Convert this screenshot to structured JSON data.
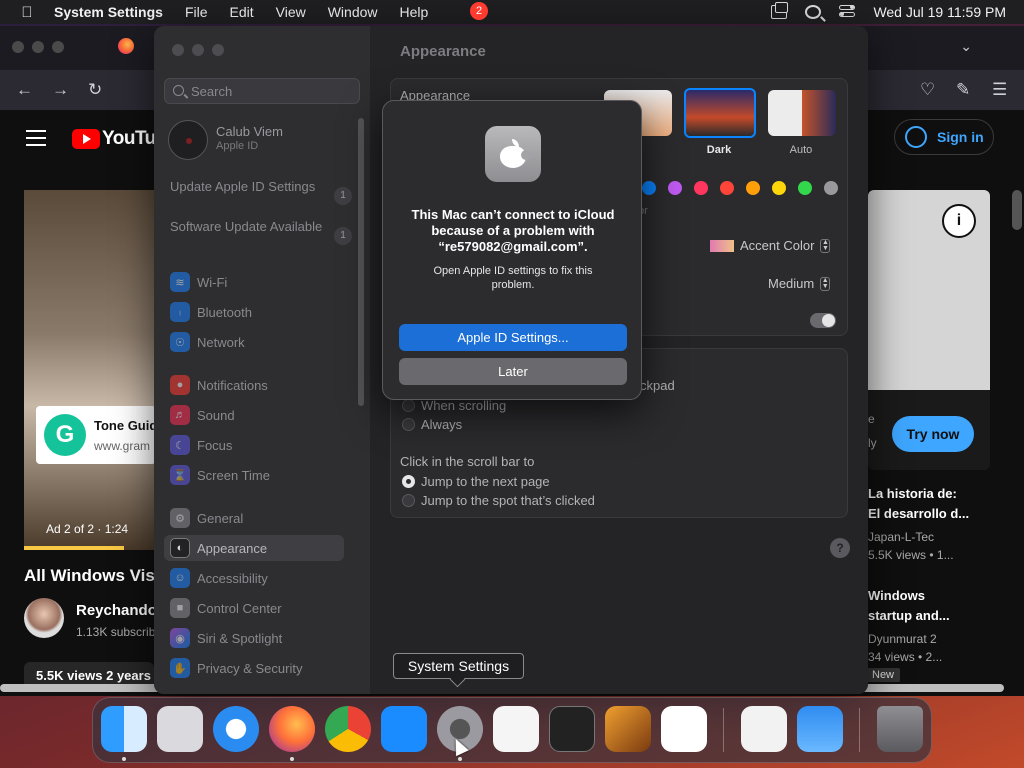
{
  "menubar": {
    "app_name": "System Settings",
    "menus": [
      "File",
      "Edit",
      "View",
      "Window",
      "Help"
    ],
    "datetime": "Wed Jul 19  11:59 PM"
  },
  "youtube": {
    "logo_text": "YouTube",
    "sign_in": "Sign in",
    "ad_title": "Tone Guid",
    "ad_url": "www.gram",
    "ad_label": "Ad 2 of 2 · 1:24",
    "video_title": "All Windows Vis",
    "channel": "Reychando",
    "subs": "1.13K subscrib",
    "views": "5.5K views  2 years",
    "try_now": "Try now",
    "right_items": [
      {
        "title1": "La historia de:",
        "title2": "El desarrollo d...",
        "channel": "Japan-L-Tec",
        "views": "5.5K views • 1..."
      },
      {
        "title1": "Windows",
        "title2": "startup and...",
        "channel": "Dyunmurat 2",
        "views": "34 views • 2..."
      }
    ],
    "new_badge": "New",
    "info_icon": "i",
    "partial_text_1": "e",
    "partial_text_2": "ly"
  },
  "settings": {
    "search_placeholder": "Search",
    "account_name": "Calub Viem",
    "account_sub": "Apple ID",
    "notices": [
      {
        "label": "Update Apple ID Settings",
        "count": "1"
      },
      {
        "label": "Software Update Available",
        "count": "1"
      }
    ],
    "sidebar_items": [
      {
        "label": "Wi-Fi",
        "icon": "wifi-icon",
        "color": "#1a82ff"
      },
      {
        "label": "Bluetooth",
        "icon": "bluetooth-icon",
        "color": "#1a82ff"
      },
      {
        "label": "Network",
        "icon": "globe-icon",
        "color": "#1a82ff"
      },
      {
        "label": "Notifications",
        "icon": "bell-icon",
        "color": "#ff3b30"
      },
      {
        "label": "Sound",
        "icon": "speaker-icon",
        "color": "#ff2d55"
      },
      {
        "label": "Focus",
        "icon": "moon-icon",
        "color": "#5e5ce6"
      },
      {
        "label": "Screen Time",
        "icon": "hourglass-icon",
        "color": "#5e5ce6"
      },
      {
        "label": "General",
        "icon": "gear-icon",
        "color": "#8e8e93"
      },
      {
        "label": "Appearance",
        "icon": "appearance-icon",
        "color": "#1c1c1e"
      },
      {
        "label": "Accessibility",
        "icon": "accessibility-icon",
        "color": "#1a82ff"
      },
      {
        "label": "Control Center",
        "icon": "control-center-icon",
        "color": "#8e8e93"
      },
      {
        "label": "Siri & Spotlight",
        "icon": "siri-icon",
        "color": "#bf5af2"
      },
      {
        "label": "Privacy & Security",
        "icon": "hand-icon",
        "color": "#1a82ff"
      }
    ],
    "content_title": "Appearance",
    "appearance_label": "Appearance",
    "themes": [
      "ht",
      "Dark",
      "Auto"
    ],
    "accent_partial": "or",
    "accent_colors": [
      "#0a84ff",
      "#bf5af2",
      "#ff375f",
      "#ff453a",
      "#ff9f0a",
      "#ffd60a",
      "#32d74b",
      "#98989d"
    ],
    "highlight_value": "Accent Color",
    "sidebar_icon_size": "Medium",
    "scroll_partial": "ckpad",
    "scroll_when": "When scrolling",
    "scroll_always": "Always",
    "click_label": "Click in the scroll bar to",
    "click_next": "Jump to the next page",
    "click_spot": "Jump to the spot that’s clicked",
    "help": "?"
  },
  "alert": {
    "headline": "This Mac can’t connect to iCloud because of a problem with “re579082@gmail.com”.",
    "message": "Open Apple ID settings to fix this problem.",
    "primary": "Apple ID Settings...",
    "secondary": "Later"
  },
  "tooltip": "System Settings",
  "dock": {
    "badge": "2",
    "items": [
      "finder-icon",
      "launchpad-icon",
      "safari-icon",
      "firefox-icon",
      "chrome-icon",
      "app-store-icon",
      "system-settings-icon",
      "textedit-icon",
      "terminal-icon",
      "garageband-icon",
      "vscode-icon",
      "visual-studio-icon",
      "weather-icon",
      "trash-icon"
    ]
  }
}
